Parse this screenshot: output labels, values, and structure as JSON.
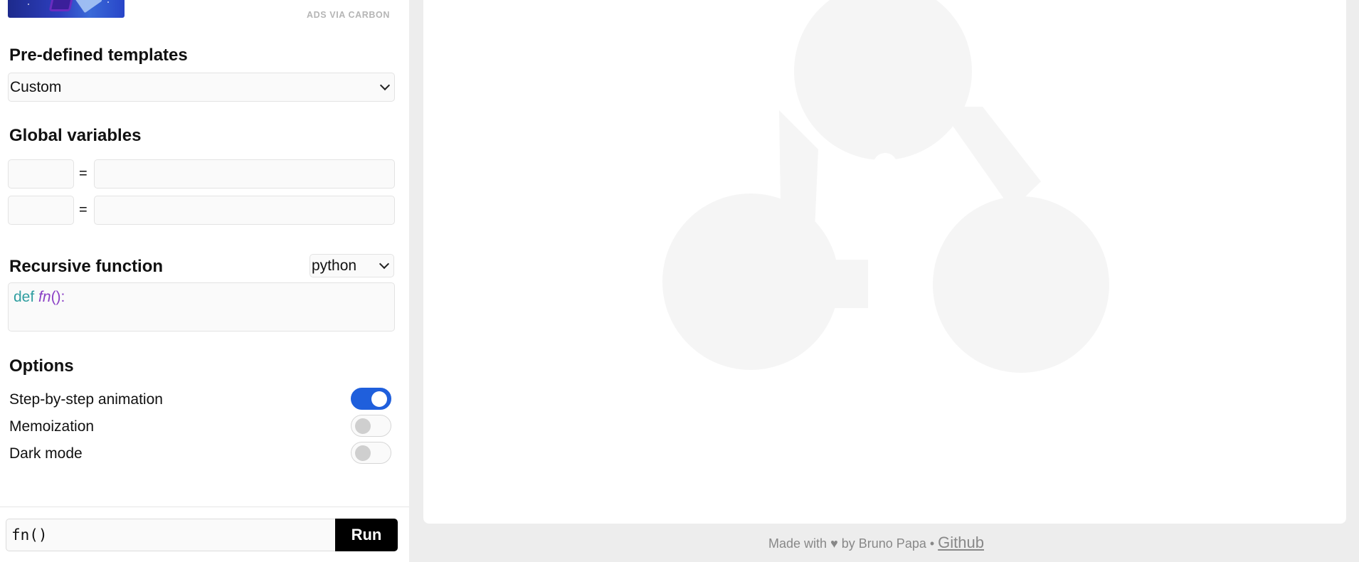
{
  "ad": {
    "label": "ADS VIA CARBON"
  },
  "templates": {
    "title": "Pre-defined templates",
    "selected": "Custom"
  },
  "globals": {
    "title": "Global variables",
    "rows": [
      {
        "name": "",
        "equals": "=",
        "value": ""
      },
      {
        "name": "",
        "equals": "=",
        "value": ""
      }
    ]
  },
  "recursive": {
    "title": "Recursive function",
    "language": "python",
    "code": {
      "keyword": "def",
      "name": "fn",
      "tail": "():"
    }
  },
  "options": {
    "title": "Options",
    "items": [
      {
        "label": "Step-by-step animation",
        "enabled": true
      },
      {
        "label": "Memoization",
        "enabled": false
      },
      {
        "label": "Dark mode",
        "enabled": false
      }
    ]
  },
  "command": {
    "value": "fn()",
    "run_label": "Run"
  },
  "footer": {
    "made_with": "Made with",
    "heart": "♥",
    "by": "by Bruno Papa •",
    "link": "Github"
  },
  "colors": {
    "accent": "#1f5fdc",
    "logo": "#f5f5f5",
    "keyword": "#2f9ea0",
    "function": "#8a3fc5"
  }
}
